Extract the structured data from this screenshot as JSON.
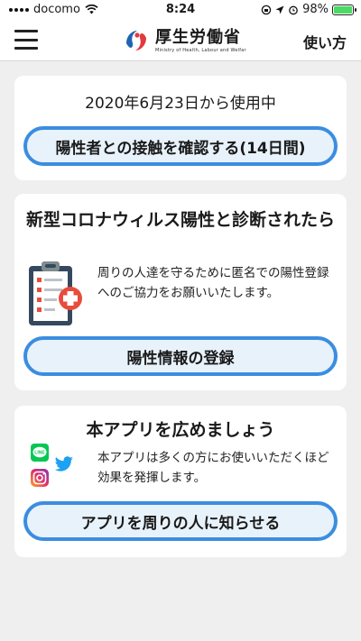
{
  "status_bar": {
    "carrier": "docomo",
    "time": "8:24",
    "battery_percent": "98%",
    "battery_level": 0.98,
    "battery_color": "#4cd964",
    "icons": [
      "signal-icon",
      "wifi-icon",
      "screen-lock-icon",
      "location-icon",
      "alarm-icon",
      "battery-icon"
    ]
  },
  "nav": {
    "menu_icon": "hamburger-menu-icon",
    "logo_text": "厚生労働省",
    "logo_subtext": "Ministry of Health, Labour and Welfar",
    "how_to_use": "使い方"
  },
  "contact_card": {
    "usage_since": "2020年6月23日から使用中",
    "check_button": "陽性者との接触を確認する(14日間)"
  },
  "register_card": {
    "title": "新型コロナウィルス陽性と診断されたら",
    "icon": "medical-clipboard-icon",
    "description": "周りの人達を守るために匿名での陽性登録へのご協力をお願いいたします。",
    "register_button": "陽性情報の登録"
  },
  "share_card": {
    "title": "本アプリを広めましょう",
    "icons": [
      "line-icon",
      "twitter-icon",
      "instagram-icon"
    ],
    "line_label": "LINE",
    "description": "本アプリは多くの方にお使いいただくほど効果を発揮します。",
    "share_button": "アプリを周りの人に知らせる"
  },
  "colors": {
    "accent": "#3b8de0",
    "button_fill": "#e8f2fb",
    "background": "#efefef"
  }
}
